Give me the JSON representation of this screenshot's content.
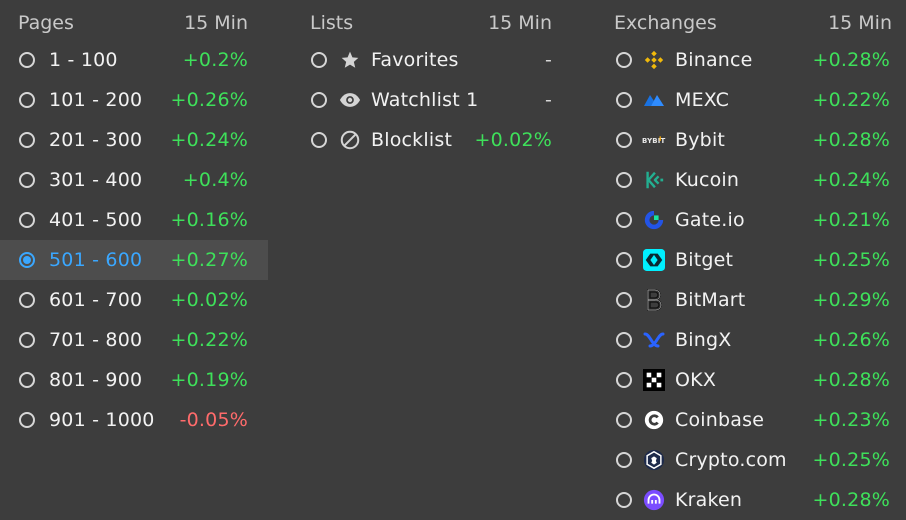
{
  "pages": {
    "title": "Pages",
    "timeframe": "15 Min",
    "items": [
      {
        "label": "1 - 100",
        "change": "+0.2%",
        "trend": "pos",
        "selected": false
      },
      {
        "label": "101 - 200",
        "change": "+0.26%",
        "trend": "pos",
        "selected": false
      },
      {
        "label": "201 - 300",
        "change": "+0.24%",
        "trend": "pos",
        "selected": false
      },
      {
        "label": "301 - 400",
        "change": "+0.4%",
        "trend": "pos",
        "selected": false
      },
      {
        "label": "401 - 500",
        "change": "+0.16%",
        "trend": "pos",
        "selected": false
      },
      {
        "label": "501 - 600",
        "change": "+0.27%",
        "trend": "pos",
        "selected": true
      },
      {
        "label": "601 - 700",
        "change": "+0.02%",
        "trend": "pos",
        "selected": false
      },
      {
        "label": "701 - 800",
        "change": "+0.22%",
        "trend": "pos",
        "selected": false
      },
      {
        "label": "801 - 900",
        "change": "+0.19%",
        "trend": "pos",
        "selected": false
      },
      {
        "label": "901 - 1000",
        "change": "-0.05%",
        "trend": "neg",
        "selected": false
      }
    ]
  },
  "lists": {
    "title": "Lists",
    "timeframe": "15 Min",
    "items": [
      {
        "label": "Favorites",
        "change": "-",
        "trend": "dash",
        "icon": "star-icon"
      },
      {
        "label": "Watchlist 1",
        "change": "-",
        "trend": "dash",
        "icon": "eye-icon"
      },
      {
        "label": "Blocklist",
        "change": "+0.02%",
        "trend": "pos",
        "icon": "block-icon"
      }
    ]
  },
  "exchanges": {
    "title": "Exchanges",
    "timeframe": "15 Min",
    "items": [
      {
        "label": "Binance",
        "change": "+0.28%",
        "trend": "pos",
        "icon": "binance-logo-icon"
      },
      {
        "label": "MEXC",
        "change": "+0.22%",
        "trend": "pos",
        "icon": "mexc-logo-icon"
      },
      {
        "label": "Bybit",
        "change": "+0.28%",
        "trend": "pos",
        "icon": "bybit-logo-icon"
      },
      {
        "label": "Kucoin",
        "change": "+0.24%",
        "trend": "pos",
        "icon": "kucoin-logo-icon"
      },
      {
        "label": "Gate.io",
        "change": "+0.21%",
        "trend": "pos",
        "icon": "gateio-logo-icon"
      },
      {
        "label": "Bitget",
        "change": "+0.25%",
        "trend": "pos",
        "icon": "bitget-logo-icon"
      },
      {
        "label": "BitMart",
        "change": "+0.29%",
        "trend": "pos",
        "icon": "bitmart-logo-icon"
      },
      {
        "label": "BingX",
        "change": "+0.26%",
        "trend": "pos",
        "icon": "bingx-logo-icon"
      },
      {
        "label": "OKX",
        "change": "+0.28%",
        "trend": "pos",
        "icon": "okx-logo-icon"
      },
      {
        "label": "Coinbase",
        "change": "+0.23%",
        "trend": "pos",
        "icon": "coinbase-logo-icon"
      },
      {
        "label": "Crypto.com",
        "change": "+0.25%",
        "trend": "pos",
        "icon": "cryptocom-logo-icon"
      },
      {
        "label": "Kraken",
        "change": "+0.28%",
        "trend": "pos",
        "icon": "kraken-logo-icon"
      }
    ]
  },
  "bybit_logo_text": "BYBIT",
  "colors": {
    "positive": "#3ee05a",
    "negative": "#ff6b6b",
    "selected": "#3aa7ff",
    "background": "#3d3d3d"
  }
}
